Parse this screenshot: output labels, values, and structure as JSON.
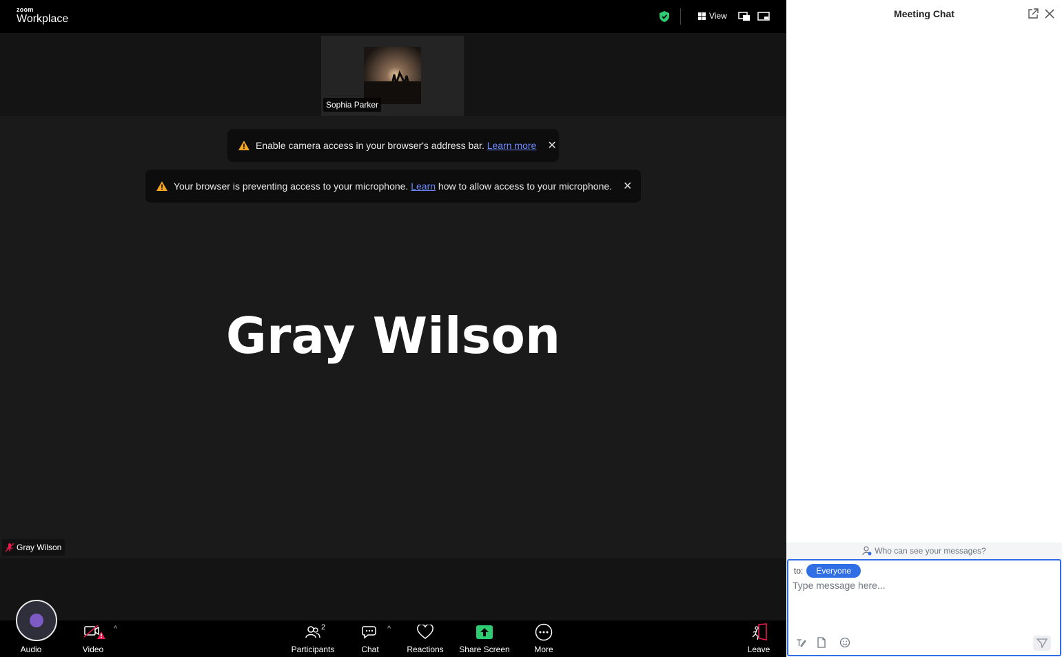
{
  "app": {
    "logo_small": "zoom",
    "logo_big": "Workplace"
  },
  "topbar": {
    "view_label": "View"
  },
  "thumbnail": {
    "name": "Sophia Parker"
  },
  "toasts": [
    {
      "text": "Enable camera access in your browser's address bar.",
      "link": "Learn more",
      "after": ""
    },
    {
      "text": "Your browser is preventing access to your microphone.",
      "link": "Learn",
      "after": "how to allow access to your microphone."
    }
  ],
  "main": {
    "speaker_name": "Gray Wilson",
    "self_label": "Gray Wilson"
  },
  "toolbar": {
    "audio": "Audio",
    "video": "Video",
    "participants": "Participants",
    "participants_count": "2",
    "chat": "Chat",
    "reactions": "Reactions",
    "share_screen": "Share Screen",
    "more": "More",
    "leave": "Leave"
  },
  "chat": {
    "title": "Meeting Chat",
    "who_can_see": "Who can see your messages?",
    "to_label": "to:",
    "recipient": "Everyone",
    "placeholder": "Type message here..."
  },
  "colors": {
    "accent": "#2f6ee5",
    "warning": "#f5a623",
    "shield": "#2ecc71",
    "danger": "#e8194c"
  }
}
